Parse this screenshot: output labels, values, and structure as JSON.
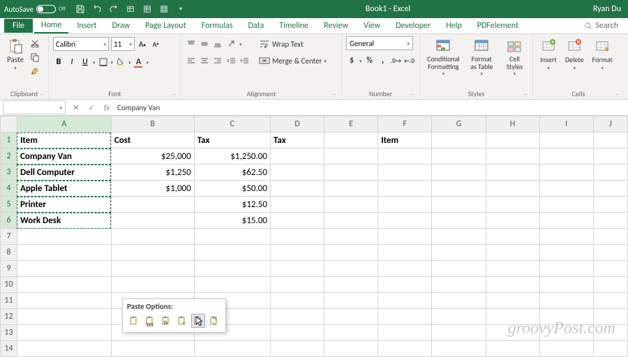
{
  "title": {
    "autosave_label": "AutoSave",
    "autosave_state": "Off",
    "doc": "Book1 - Excel",
    "user": "Ryan Du"
  },
  "tabs": {
    "file": "File",
    "home": "Home",
    "insert": "Insert",
    "draw": "Draw",
    "pagelayout": "Page Layout",
    "formulas": "Formulas",
    "data": "Data",
    "timeline": "Timeline",
    "review": "Review",
    "view": "View",
    "developer": "Developer",
    "help": "Help",
    "pdfelement": "PDFelement",
    "search": "Search"
  },
  "ribbon": {
    "clipboard": {
      "paste": "Paste",
      "label": "Clipboard"
    },
    "font": {
      "name": "Calibri",
      "size": "11",
      "label": "Font"
    },
    "alignment": {
      "wrap": "Wrap Text",
      "merge": "Merge & Center",
      "label": "Alignment"
    },
    "number": {
      "format": "General",
      "label": "Number"
    },
    "styles": {
      "cond": "Conditional Formatting",
      "table": "Format as Table",
      "cell": "Cell Styles",
      "label": "Styles"
    },
    "cells": {
      "insert": "Insert",
      "delete": "Delete",
      "format": "Format",
      "label": "Cells"
    }
  },
  "formula": {
    "fx": "fx",
    "value": "Company Van"
  },
  "columns": [
    "A",
    "B",
    "C",
    "D",
    "E",
    "F",
    "G",
    "H",
    "I",
    "J"
  ],
  "rows": [
    "1",
    "2",
    "3",
    "4",
    "5",
    "6",
    "7",
    "8",
    "9",
    "10",
    "11",
    "12",
    "13",
    "14"
  ],
  "cells": {
    "A1": "Item",
    "B1": "Cost",
    "C1": "Tax",
    "D1": "Tax",
    "F1": "Item",
    "A2": "Company Van",
    "B2": "$25,000",
    "C2": "$1,250.00",
    "A3": "Dell Computer",
    "B3": "$1,250",
    "C3": "$62.50",
    "A4": "Apple Tablet",
    "B4": "$1,000",
    "C4": "$50.00",
    "A5": "Printer",
    "C5": "$12.50",
    "A6": "Work Desk",
    "C6": "$15.00"
  },
  "paste_popup": {
    "title": "Paste Options:",
    "hint": "123"
  },
  "watermark": "groovyPost.com"
}
